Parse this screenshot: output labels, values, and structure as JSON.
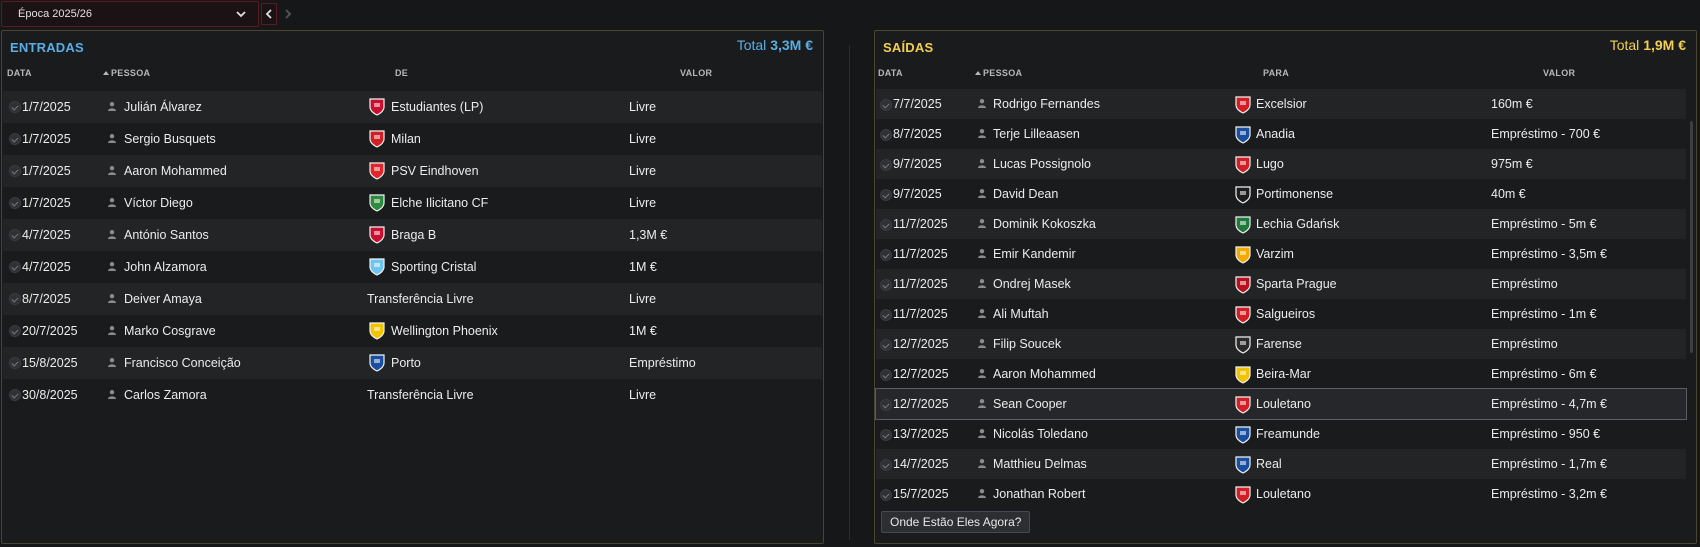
{
  "season": {
    "label": "Época 2025/26"
  },
  "icons": {
    "dropdown": "chevron-down-icon",
    "prev": "chevron-left-icon",
    "next": "chevron-right-icon",
    "person": "person-icon",
    "check": "check-icon"
  },
  "entradas": {
    "title": "ENTRADAS",
    "total_label": "Total",
    "total_value": "3,3M €",
    "columns": {
      "date": "DATA",
      "person": "PESSOA",
      "from": "DE",
      "value": "VALOR"
    },
    "rows": [
      {
        "date": "1/7/2025",
        "person": "Julián Álvarez",
        "club": "Estudiantes (LP)",
        "value": "Livre",
        "crest": "#c8102e"
      },
      {
        "date": "1/7/2025",
        "person": "Sergio Busquets",
        "club": "Milan",
        "value": "Livre",
        "crest": "#d11f26"
      },
      {
        "date": "1/7/2025",
        "person": "Aaron Mohammed",
        "club": "PSV Eindhoven",
        "value": "Livre",
        "crest": "#e3242b"
      },
      {
        "date": "1/7/2025",
        "person": "Víctor Diego",
        "club": "Elche Ilicitano CF",
        "value": "Livre",
        "crest": "#2e8b3e"
      },
      {
        "date": "4/7/2025",
        "person": "António Santos",
        "club": "Braga B",
        "value": "1,3M €",
        "crest": "#c8102e"
      },
      {
        "date": "4/7/2025",
        "person": "John Alzamora",
        "club": "Sporting Cristal",
        "value": "1M €",
        "crest": "#6ec6f0"
      },
      {
        "date": "8/7/2025",
        "person": "Deiver Amaya",
        "club": "Transferência Livre",
        "value": "Livre",
        "crest": ""
      },
      {
        "date": "20/7/2025",
        "person": "Marko Cosgrave",
        "club": "Wellington Phoenix",
        "value": "1M €",
        "crest": "#f2c300"
      },
      {
        "date": "15/8/2025",
        "person": "Francisco Conceição",
        "club": "Porto",
        "value": "Empréstimo",
        "crest": "#1a4fa0"
      },
      {
        "date": "30/8/2025",
        "person": "Carlos Zamora",
        "club": "Transferência Livre",
        "value": "Livre",
        "crest": ""
      }
    ]
  },
  "saidas": {
    "title": "SAÍDAS",
    "total_label": "Total",
    "total_value": "1,9M €",
    "columns": {
      "date": "DATA",
      "person": "PESSOA",
      "to": "PARA",
      "value": "VALOR"
    },
    "rows": [
      {
        "date": "7/7/2025",
        "person": "Rodrigo Fernandes",
        "club": "Excelsior",
        "value": "160m €",
        "crest": "#d11f26"
      },
      {
        "date": "8/7/2025",
        "person": "Terje Lilleaasen",
        "club": "Anadia",
        "value": "Empréstimo - 700 €",
        "crest": "#1a4fa0"
      },
      {
        "date": "9/7/2025",
        "person": "Lucas Possignolo",
        "club": "Lugo",
        "value": "975m €",
        "crest": "#d11f26"
      },
      {
        "date": "9/7/2025",
        "person": "David Dean",
        "club": "Portimonense",
        "value": "40m €",
        "crest": "#1d1d1d"
      },
      {
        "date": "11/7/2025",
        "person": "Dominik Kokoszka",
        "club": "Lechia Gdańsk",
        "value": "Empréstimo - 5m €",
        "crest": "#1e7a3a"
      },
      {
        "date": "11/7/2025",
        "person": "Emir Kandemir",
        "club": "Varzim",
        "value": "Empréstimo - 3,5m €",
        "crest": "#f2a900"
      },
      {
        "date": "11/7/2025",
        "person": "Ondrej Masek",
        "club": "Sparta Prague",
        "value": "Empréstimo",
        "crest": "#b5121b"
      },
      {
        "date": "11/7/2025",
        "person": "Ali Muftah",
        "club": "Salgueiros",
        "value": "Empréstimo - 1m €",
        "crest": "#d11f26"
      },
      {
        "date": "12/7/2025",
        "person": "Filip Soucek",
        "club": "Farense",
        "value": "Empréstimo",
        "crest": "#2a2a2a"
      },
      {
        "date": "12/7/2025",
        "person": "Aaron Mohammed",
        "club": "Beira-Mar",
        "value": "Empréstimo - 6m €",
        "crest": "#f2c300"
      },
      {
        "date": "12/7/2025",
        "person": "Sean Cooper",
        "club": "Louletano",
        "value": "Empréstimo - 4,7m €",
        "crest": "#d11f26"
      },
      {
        "date": "13/7/2025",
        "person": "Nicolás Toledano",
        "club": "Freamunde",
        "value": "Empréstimo - 950 €",
        "crest": "#1a4fa0"
      },
      {
        "date": "14/7/2025",
        "person": "Matthieu Delmas",
        "club": "Real",
        "value": "Empréstimo - 1,7m €",
        "crest": "#1a4fa0"
      },
      {
        "date": "15/7/2025",
        "person": "Jonathan Robert",
        "club": "Louletano",
        "value": "Empréstimo - 3,2m €",
        "crest": "#d11f26"
      }
    ],
    "button_label": "Onde Estão Eles Agora?"
  }
}
